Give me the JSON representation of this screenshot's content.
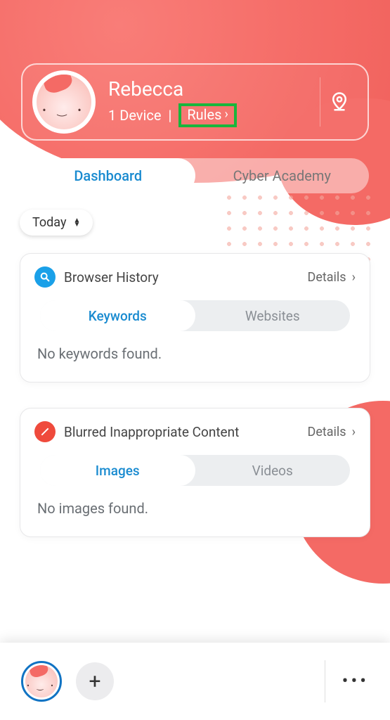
{
  "header": {
    "name": "Rebecca",
    "device_text": "1 Device",
    "rules_label": "Rules"
  },
  "tabs": {
    "main": [
      "Dashboard",
      "Cyber Academy"
    ]
  },
  "date_range": {
    "label": "Today"
  },
  "cards": [
    {
      "title": "Browser History",
      "details_label": "Details",
      "tabs": [
        "Keywords",
        "Websites"
      ],
      "empty_text": "No keywords found."
    },
    {
      "title": "Blurred Inappropriate Content",
      "details_label": "Details",
      "tabs": [
        "Images",
        "Videos"
      ],
      "empty_text": "No images found."
    }
  ],
  "colors": {
    "accent_red": "#f46a65",
    "accent_blue": "#1a8bd0",
    "highlight_green": "#18b63c"
  }
}
